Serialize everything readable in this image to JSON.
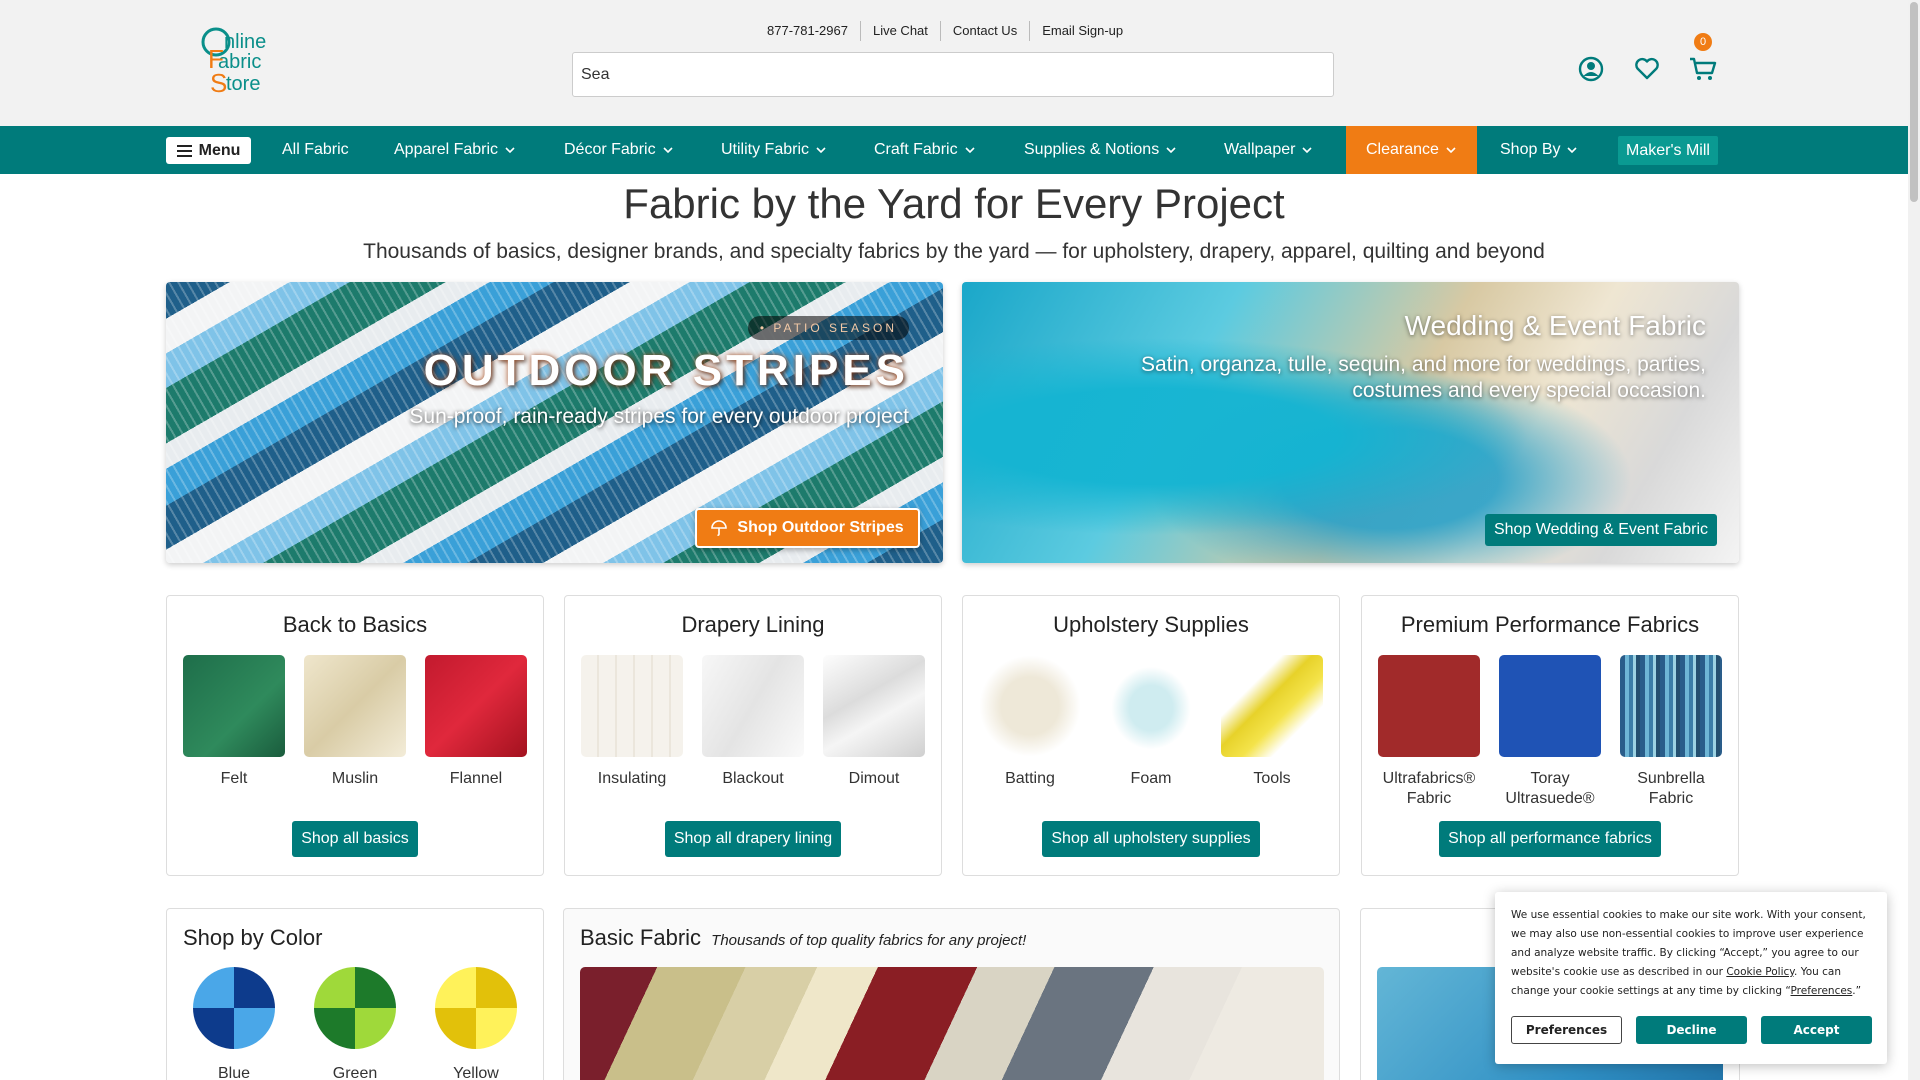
{
  "header": {
    "logo_text": [
      "Online",
      "Fabric",
      "Store"
    ],
    "util_links": [
      "877-781-2967",
      "Live Chat",
      "Contact Us",
      "Email Sign-up"
    ],
    "search_value": "Sea",
    "cart_count": "0",
    "icons": [
      "account-icon",
      "heart-icon",
      "cart-icon"
    ]
  },
  "nav": {
    "menu_label": "Menu",
    "items": [
      {
        "label": "All Fabric"
      },
      {
        "label": "Apparel Fabric"
      },
      {
        "label": "Décor Fabric"
      },
      {
        "label": "Utility Fabric"
      },
      {
        "label": "Craft Fabric"
      },
      {
        "label": "Supplies & Notions"
      },
      {
        "label": "Wallpaper"
      },
      {
        "label": "Clearance"
      },
      {
        "label": "Shop By"
      },
      {
        "label": "Maker's Mill"
      }
    ]
  },
  "hero": {
    "title": "Fabric by the Yard for Every Project",
    "subtitle": "Thousands of basics, designer brands, and specialty fabrics by the yard — for upholstery, drapery, apparel, quilting and beyond"
  },
  "banners": {
    "outdoor": {
      "tag": "• PATIO SEASON",
      "title": "OUTDOOR STRIPES",
      "subtitle": "Sun-proof, rain-ready stripes for every outdoor project",
      "button": "Shop Outdoor Stripes"
    },
    "wedding": {
      "title": "Wedding & Event Fabric",
      "subtitle": "Satin, organza, tulle, sequin, and more for weddings, parties, costumes and every special occasion.",
      "button": "Shop Wedding & Event Fabric"
    }
  },
  "cards": [
    {
      "title": "Back to Basics",
      "items": [
        "Felt",
        "Muslin",
        "Flannel"
      ],
      "button": "Shop all basics"
    },
    {
      "title": "Drapery Lining",
      "items": [
        "Insulating",
        "Blackout",
        "Dimout"
      ],
      "button": "Shop all drapery lining"
    },
    {
      "title": "Upholstery Supplies",
      "items": [
        "Batting",
        "Foam",
        "Tools"
      ],
      "button": "Shop all upholstery supplies"
    },
    {
      "title": "Premium Performance Fabrics",
      "items": [
        "Ultrafabrics® Fabric",
        "Toray Ultrasuede®",
        "Sunbrella Fabric"
      ],
      "button": "Shop all performance fabrics"
    }
  ],
  "colors": {
    "title": "Shop by Color",
    "items": [
      "Blue",
      "Green",
      "Yellow"
    ]
  },
  "basic": {
    "title": "Basic Fabric",
    "tagline": "Thousands of top quality fabrics for any project!"
  },
  "cookie": {
    "text_1": "We use essential cookies to make our site work. With your consent, we may also use non-essential cookies to improve user experience and analyze website traffic. By clicking “Accept,” you agree to our website's cookie use as described in our ",
    "cookie_policy": "Cookie Policy",
    "text_2": ". You can change your cookie settings at any time by clicking “",
    "preferences_link": "Preferences",
    "text_3": ".”",
    "buttons": [
      "Preferences",
      "Decline",
      "Accept"
    ]
  },
  "colors_theme": {
    "teal": "#007b7b",
    "orange": "#f07c14"
  }
}
